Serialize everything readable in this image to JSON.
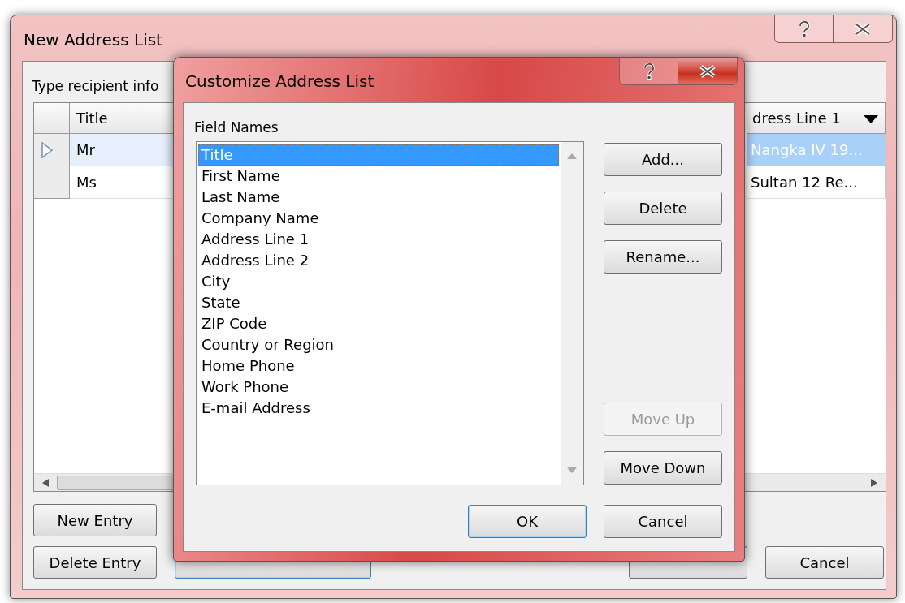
{
  "back_window": {
    "title": "New Address List",
    "instruction": "Type recipient info",
    "columns": [
      {
        "label": "Title",
        "dropdown": false
      },
      {
        "label": "dress Line 1",
        "dropdown": true
      }
    ],
    "rows": [
      {
        "selected": true,
        "cells": [
          "Mr",
          "Nangka IV 19..."
        ]
      },
      {
        "selected": false,
        "cells": [
          "Ms",
          "Sultan 12 Re..."
        ]
      }
    ],
    "left_buttons": [
      "New Entry",
      "Delete Entry"
    ],
    "hidden_buttons": [
      {
        "kind": "default"
      },
      {
        "kind": "normal"
      }
    ],
    "cancel_button": "Cancel"
  },
  "dialog": {
    "title": "Customize Address List",
    "list_label": "Field Names",
    "fields": [
      {
        "label": "Title",
        "selected": true
      },
      {
        "label": "First Name",
        "selected": false
      },
      {
        "label": "Last Name",
        "selected": false
      },
      {
        "label": "Company Name",
        "selected": false
      },
      {
        "label": "Address Line 1",
        "selected": false
      },
      {
        "label": "Address Line 2",
        "selected": false
      },
      {
        "label": "City",
        "selected": false
      },
      {
        "label": "State",
        "selected": false
      },
      {
        "label": "ZIP Code",
        "selected": false
      },
      {
        "label": "Country or Region",
        "selected": false
      },
      {
        "label": "Home Phone",
        "selected": false
      },
      {
        "label": "Work Phone",
        "selected": false
      },
      {
        "label": "E-mail Address",
        "selected": false
      }
    ],
    "side_buttons": [
      {
        "label": "Add...",
        "disabled": false
      },
      {
        "label": "Delete",
        "disabled": false
      },
      {
        "label": "Rename...",
        "disabled": false
      },
      {
        "label": "Move Up",
        "disabled": true
      },
      {
        "label": "Move Down",
        "disabled": false
      }
    ],
    "ok_button": "OK",
    "cancel_button": "Cancel"
  }
}
